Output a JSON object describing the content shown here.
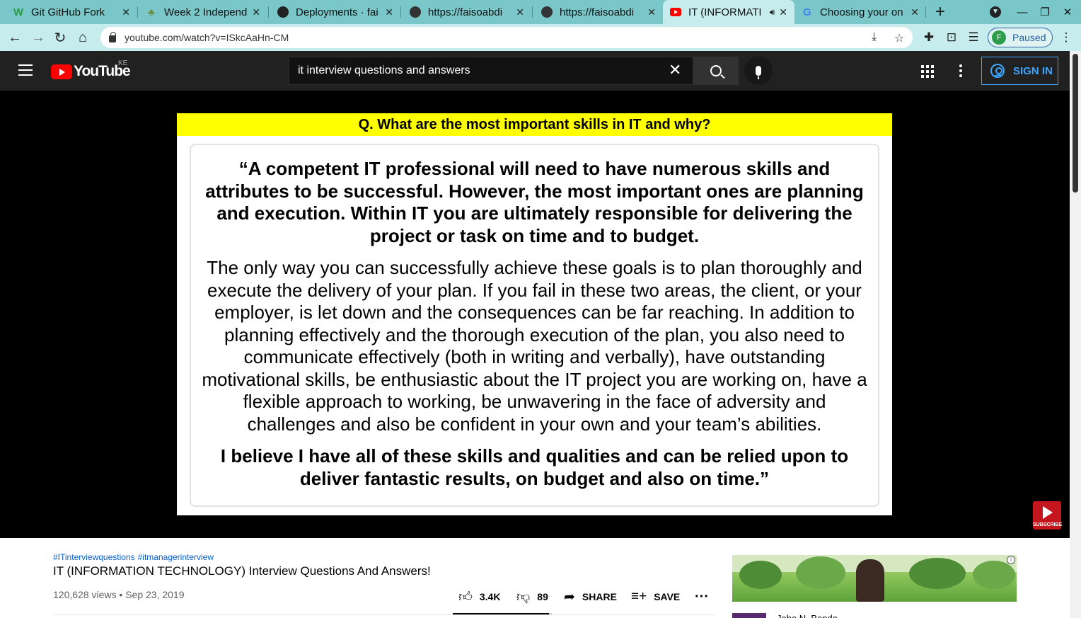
{
  "browser": {
    "tabs": [
      {
        "title": "Git GitHub Fork",
        "favicon": "w-icon"
      },
      {
        "title": "Week 2 Independe",
        "favicon": "tree-icon"
      },
      {
        "title": "Deployments · fai",
        "favicon": "github-icon"
      },
      {
        "title": "https://faisoabdi",
        "favicon": "globe-icon"
      },
      {
        "title": "https://faisoabdi",
        "favicon": "globe-icon"
      },
      {
        "title": "IT (INFORMATI",
        "favicon": "youtube-icon",
        "active": true,
        "audio": true
      },
      {
        "title": "Choosing your on",
        "favicon": "google-icon"
      }
    ],
    "url": "youtube.com/watch?v=ISkcAaHn-CM",
    "profile_initial": "F",
    "profile_status": "Paused"
  },
  "youtube": {
    "logo_text": "YouTube",
    "country_code": "KE",
    "search_value": "it interview questions and answers",
    "signin_label": "SIGN IN"
  },
  "slide": {
    "question": "Q. What are the most important skills in IT and why?",
    "para1": "“A competent IT professional will need to have numerous skills and attributes to be successful. However, the most important ones are planning and execution. Within IT you are ultimately responsible for delivering the project or task on time and to budget.",
    "para2": "The only way you can successfully achieve these goals is to plan thoroughly and execute the delivery of your plan. If you fail in these two areas, the client, or your employer, is let down and the consequences can be far reaching. In addition to planning effectively and the thorough execution of the plan, you also need to communicate effectively (both in writing and verbally), have outstanding motivational skills, be enthusiastic about the IT project you are working on, have a flexible approach to working, be unwavering in the face of adversity and challenges and also be confident in your own and your team’s abilities.",
    "para3": "I believe I have all of these skills and qualities and can be relied upon to deliver fantastic results, on budget and also on time.”",
    "subscribe_label": "SUBSCRIBE"
  },
  "video": {
    "hashtags": [
      "#ITinterviewquestions",
      "#itmanagerinterview"
    ],
    "title": "IT (INFORMATION TECHNOLOGY) Interview Questions And Answers!",
    "views": "120,628 views",
    "date": "Sep 23, 2019",
    "likes": "3.4K",
    "dislikes": "89",
    "share_label": "SHARE",
    "save_label": "SAVE",
    "like_ratio": 0.97
  },
  "sidebar": {
    "next_title": "Jaha N. Banda"
  },
  "colors": {
    "tabstrip": "#79c7c9",
    "toolbar": "#c6ecee",
    "masthead": "#212121",
    "question_bar": "#ffff00",
    "link_blue": "#065fd4",
    "signin_blue": "#3ea6ff"
  }
}
